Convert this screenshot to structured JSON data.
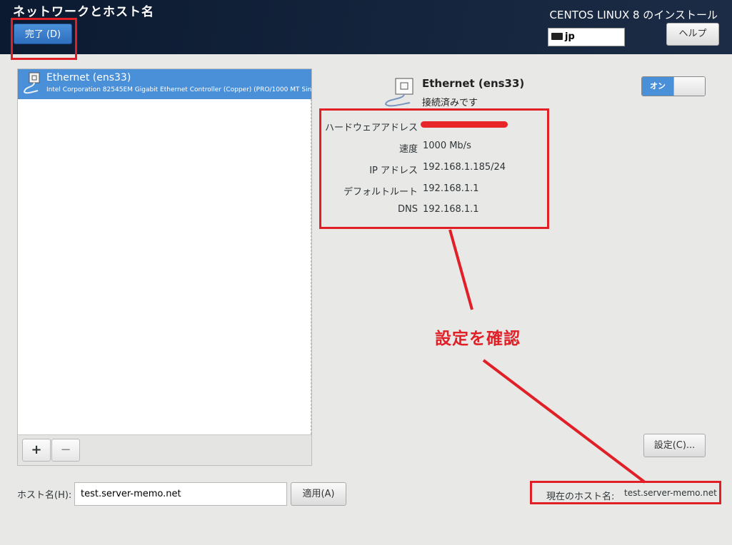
{
  "header": {
    "title": "ネットワークとホスト名",
    "done_button": "完了 (D)",
    "install_title": "CENTOS LINUX 8 のインストール",
    "keyboard_layout": "jp",
    "help_button": "ヘルプ"
  },
  "device_list": {
    "items": [
      {
        "name": "Ethernet (ens33)",
        "description": "Intel Corporation 82545EM Gigabit Ethernet Controller (Copper) (PRO/1000 MT Single Port Adapter)",
        "selected": true
      }
    ],
    "add_button": "+",
    "remove_button": "−"
  },
  "hostname": {
    "label": "ホスト名(H):",
    "value": "test.server-memo.net",
    "apply_button": "適用(A)"
  },
  "device_detail": {
    "name": "Ethernet (ens33)",
    "status": "接続済みです",
    "toggle_label": "オン",
    "toggle_state": "on",
    "rows": [
      {
        "label": "ハードウェアアドレス",
        "value": ""
      },
      {
        "label": "速度",
        "value": "1000 Mb/s"
      },
      {
        "label": "IP アドレス",
        "value": "192.168.1.185/24"
      },
      {
        "label": "デフォルトルート",
        "value": "192.168.1.1"
      },
      {
        "label": "DNS",
        "value": "192.168.1.1"
      }
    ],
    "settings_button": "設定(C)..."
  },
  "current_hostname": {
    "label": "現在のホスト名:",
    "value": "test.server-memo.net"
  },
  "annotation": {
    "text": "設定を確認",
    "color": "#e01f26"
  },
  "colors": {
    "accent": "#4a90d9",
    "header_bg": "#14243c",
    "window_bg": "#e8e8e7"
  }
}
